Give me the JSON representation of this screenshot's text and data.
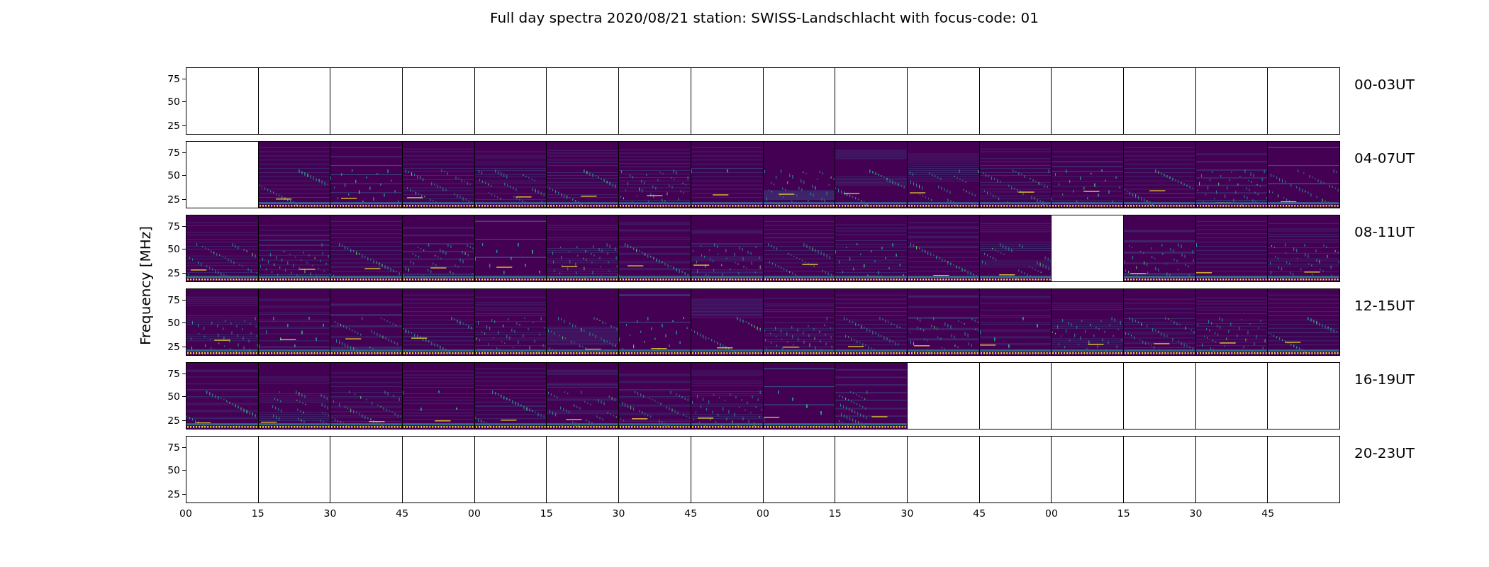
{
  "title": "Full day spectra 2020/08/21 station: SWISS-Landschlacht with focus-code: 01",
  "ylabel": "Frequency [MHz]",
  "rows": [
    {
      "label": "00-03UT",
      "yticks": [
        "75",
        "50",
        "25"
      ],
      "panels": [
        {
          "has_data": false
        },
        {
          "has_data": false
        },
        {
          "has_data": false
        },
        {
          "has_data": false
        },
        {
          "has_data": false
        },
        {
          "has_data": false
        },
        {
          "has_data": false
        },
        {
          "has_data": false
        },
        {
          "has_data": false
        },
        {
          "has_data": false
        },
        {
          "has_data": false
        },
        {
          "has_data": false
        },
        {
          "has_data": false
        },
        {
          "has_data": false
        },
        {
          "has_data": false
        },
        {
          "has_data": false
        }
      ]
    },
    {
      "label": "04-07UT",
      "yticks": [
        "75",
        "50",
        "25"
      ],
      "panels": [
        {
          "has_data": false
        },
        {
          "has_data": true
        },
        {
          "has_data": true
        },
        {
          "has_data": true
        },
        {
          "has_data": true
        },
        {
          "has_data": true
        },
        {
          "has_data": true
        },
        {
          "has_data": true
        },
        {
          "has_data": true
        },
        {
          "has_data": true
        },
        {
          "has_data": true
        },
        {
          "has_data": true
        },
        {
          "has_data": true
        },
        {
          "has_data": true
        },
        {
          "has_data": true
        },
        {
          "has_data": true
        }
      ]
    },
    {
      "label": "08-11UT",
      "yticks": [
        "75",
        "50",
        "25"
      ],
      "panels": [
        {
          "has_data": true
        },
        {
          "has_data": true
        },
        {
          "has_data": true
        },
        {
          "has_data": true
        },
        {
          "has_data": true
        },
        {
          "has_data": true
        },
        {
          "has_data": true
        },
        {
          "has_data": true
        },
        {
          "has_data": true
        },
        {
          "has_data": true
        },
        {
          "has_data": true
        },
        {
          "has_data": true
        },
        {
          "has_data": false
        },
        {
          "has_data": true
        },
        {
          "has_data": true
        },
        {
          "has_data": true
        }
      ]
    },
    {
      "label": "12-15UT",
      "yticks": [
        "75",
        "50",
        "25"
      ],
      "panels": [
        {
          "has_data": true
        },
        {
          "has_data": true
        },
        {
          "has_data": true
        },
        {
          "has_data": true
        },
        {
          "has_data": true
        },
        {
          "has_data": true
        },
        {
          "has_data": true
        },
        {
          "has_data": true
        },
        {
          "has_data": true
        },
        {
          "has_data": true
        },
        {
          "has_data": true
        },
        {
          "has_data": true
        },
        {
          "has_data": true
        },
        {
          "has_data": true
        },
        {
          "has_data": true
        },
        {
          "has_data": true
        }
      ]
    },
    {
      "label": "16-19UT",
      "yticks": [
        "75",
        "50",
        "25"
      ],
      "panels": [
        {
          "has_data": true
        },
        {
          "has_data": true
        },
        {
          "has_data": true
        },
        {
          "has_data": true
        },
        {
          "has_data": true
        },
        {
          "has_data": true
        },
        {
          "has_data": true
        },
        {
          "has_data": true
        },
        {
          "has_data": true
        },
        {
          "has_data": true
        },
        {
          "has_data": false
        },
        {
          "has_data": false
        },
        {
          "has_data": false
        },
        {
          "has_data": false
        },
        {
          "has_data": false
        },
        {
          "has_data": false
        }
      ]
    },
    {
      "label": "20-23UT",
      "yticks": [
        "75",
        "50",
        "25"
      ],
      "panels": [
        {
          "has_data": false
        },
        {
          "has_data": false
        },
        {
          "has_data": false
        },
        {
          "has_data": false
        },
        {
          "has_data": false
        },
        {
          "has_data": false
        },
        {
          "has_data": false
        },
        {
          "has_data": false
        },
        {
          "has_data": false
        },
        {
          "has_data": false
        },
        {
          "has_data": false
        },
        {
          "has_data": false
        },
        {
          "has_data": false
        },
        {
          "has_data": false
        },
        {
          "has_data": false
        },
        {
          "has_data": false
        }
      ]
    }
  ],
  "xticks": [
    "00",
    "15",
    "30",
    "45",
    "00",
    "15",
    "30",
    "45",
    "00",
    "15",
    "30",
    "45",
    "00",
    "15",
    "30",
    "45"
  ]
}
